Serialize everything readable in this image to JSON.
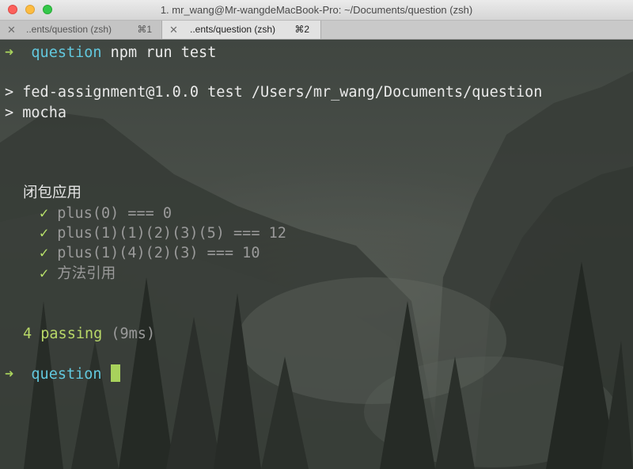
{
  "window": {
    "title": "1. mr_wang@Mr-wangdeMacBook-Pro: ~/Documents/question (zsh)"
  },
  "tabs": [
    {
      "close_glyph": "✕",
      "label": "..ents/question (zsh)",
      "shortcut": "⌘1",
      "active": false
    },
    {
      "close_glyph": "✕",
      "label": "..ents/question (zsh)",
      "shortcut": "⌘2",
      "active": true
    }
  ],
  "terminal": {
    "prompt_arrow": "➜",
    "prompt_dir": "question",
    "command": "npm run test",
    "script_line_1": "> fed-assignment@1.0.0 test /Users/mr_wang/Documents/question",
    "script_line_2": "> mocha",
    "suite_title": "闭包应用",
    "check_glyph": "✓",
    "tests": [
      {
        "name": "plus(0) === 0"
      },
      {
        "name": "plus(1)(1)(2)(3)(5) === 12"
      },
      {
        "name": "plus(1)(4)(2)(3) === 10"
      },
      {
        "name": "方法引用"
      }
    ],
    "passing_text": "4 passing",
    "passing_duration": "(9ms)",
    "final_prompt_dir": "question"
  },
  "colors": {
    "prompt_arrow": "#a8d25c",
    "prompt_dir": "#62c8de",
    "check": "#b9e26a",
    "passing": "#b9d868",
    "cursor": "#a8d25c"
  }
}
